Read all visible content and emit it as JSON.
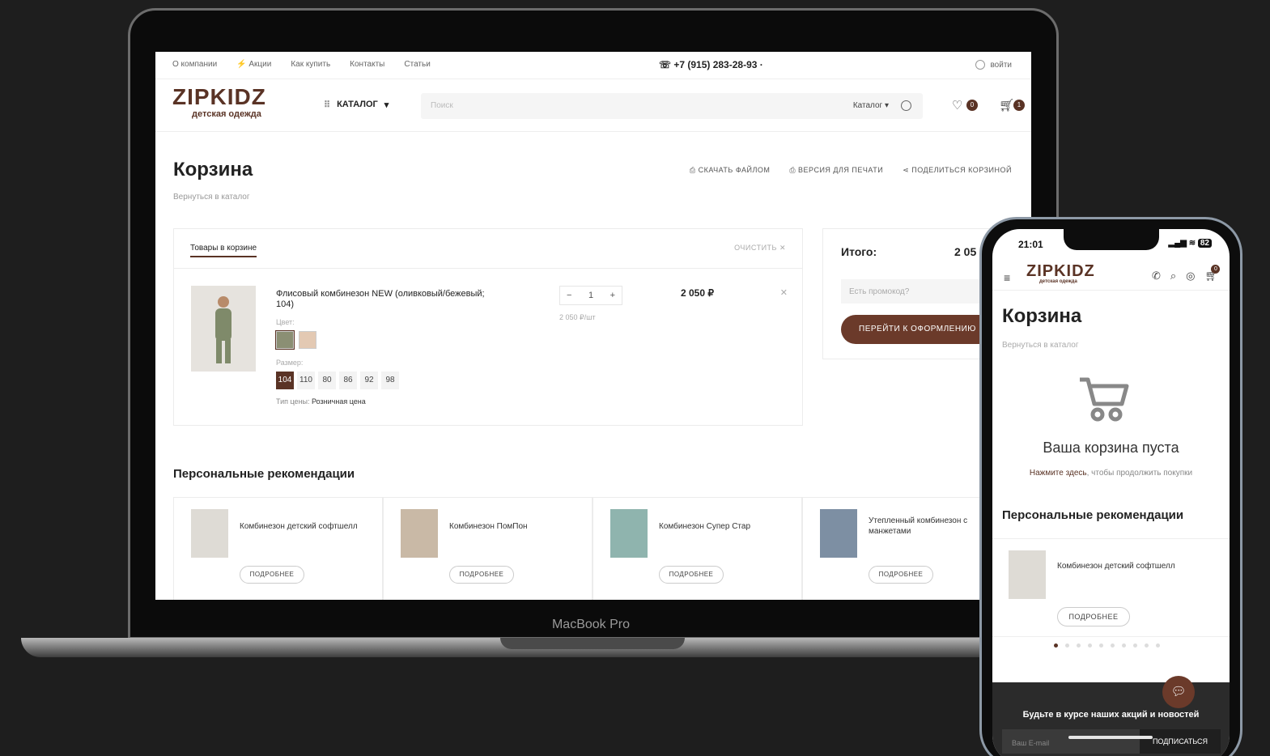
{
  "laptop": {
    "device_label": "MacBook Pro",
    "topbar": {
      "nav": [
        "О компании",
        "Акции",
        "Как купить",
        "Контакты",
        "Статьи"
      ],
      "phone": "+7 (915) 283-28-93 ·",
      "login": "войти"
    },
    "header": {
      "logo": "ZIPKIDZ",
      "logo_sub": "детская одежда",
      "catalog": "КАТАЛОГ",
      "search_placeholder": "Поиск",
      "search_scope": "Каталог",
      "wishlist_count": "0",
      "cart_count": "1"
    },
    "page": {
      "title": "Корзина",
      "back": "Вернуться в каталог",
      "tools": [
        "СКАЧАТЬ ФАЙЛОМ",
        "ВЕРСИЯ ДЛЯ ПЕЧАТИ",
        "ПОДЕЛИТЬСЯ КОРЗИНОЙ"
      ]
    },
    "cart": {
      "tab": "Товары в корзине",
      "clear": "ОЧИСТИТЬ ✕",
      "item": {
        "name": "Флисовый комбинезон NEW (оливковый/бежевый; 104)",
        "color_label": "Цвет:",
        "size_label": "Размер:",
        "sizes": [
          "104",
          "110",
          "80",
          "86",
          "92",
          "98"
        ],
        "price_type_label": "Тип цены:",
        "price_type": "Розничная цена",
        "qty": "1",
        "unit_price": "2 050 ₽/шт",
        "price": "2 050 ₽"
      }
    },
    "summary": {
      "total_label": "Итого:",
      "total_value": "2 05",
      "promo_placeholder": "Есть промокод?",
      "checkout": "ПЕРЕЙТИ К ОФОРМЛЕНИЮ"
    },
    "recommendations": {
      "title": "Персональные рекомендации",
      "button": "ПОДРОБНЕЕ",
      "items": [
        "Комбинезон детский софтшелл",
        "Комбинезон ПомПон",
        "Комбинезон Супер Стар",
        "Утепленный комбинезон с манжетами"
      ]
    }
  },
  "phone": {
    "time": "21:01",
    "battery": "82",
    "logo": "ZIPKIDZ",
    "logo_sub": "детская одежда",
    "cart_badge": "0",
    "title": "Корзина",
    "back": "Вернуться в каталог",
    "empty": "Ваша корзина пуста",
    "hint_link": "Нажмите здесь",
    "hint_rest": ", чтобы продолжить покупки",
    "rec_title": "Персональные рекомендации",
    "rec_item": "Комбинезон детский софтшелл",
    "rec_button": "ПОДРОБНЕЕ",
    "footer_title": "Будьте в курсе наших акций и новостей",
    "email_placeholder": "Ваш E-mail",
    "subscribe": "ПОДПИСАТЬСЯ"
  },
  "colors": {
    "brand": "#5a3325",
    "accent": "#6b3a2a"
  }
}
